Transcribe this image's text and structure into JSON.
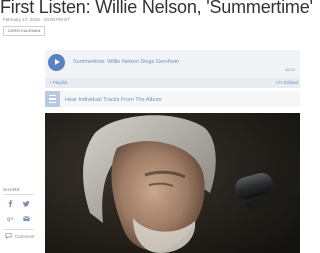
{
  "article": {
    "headline": "First Listen: Willie Nelson, 'Summertime'",
    "dateline": "February 17, 2016 · 10:00 PM ET",
    "author_button": "CHRIS KALEMAN"
  },
  "player": {
    "track_title": "Summertime: Willie Nelson Sings Gershwin",
    "duration": "38:34",
    "playlist_label": "Playlist",
    "embed_label": "Embed"
  },
  "tracks": {
    "label": "Hear Individual Tracks From The Album"
  },
  "share": {
    "label": "SHARE",
    "comment_label": "Comment",
    "icons": [
      "facebook-icon",
      "twitter-icon",
      "google-plus-icon",
      "email-icon",
      "comment-icon"
    ]
  },
  "colors": {
    "accent": "#5a82c2",
    "link": "#6e8fc6"
  }
}
